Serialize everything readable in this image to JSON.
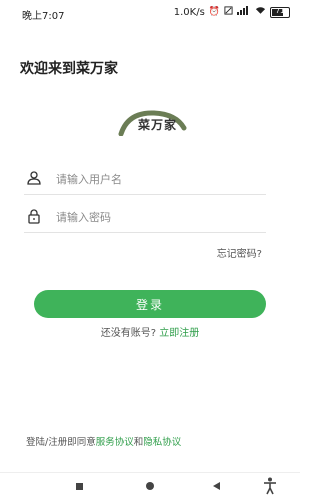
{
  "status_bar": {
    "time": "晚上7:07",
    "speed": "1.0K/s",
    "icons": [
      "alarm-icon",
      "mute-icon",
      "signal-icon",
      "wifi-icon",
      "battery-icon"
    ],
    "battery_label": "71",
    "battery_level": 0.71
  },
  "welcome_text": "欢迎来到菜万家",
  "logo": {
    "text": "菜万家"
  },
  "form": {
    "username_placeholder": "请输入用户名",
    "password_placeholder": "请输入密码",
    "forgot_label": "忘记密码?",
    "login_label": "登录",
    "no_account_text": "还没有账号?",
    "register_label": "立即注册"
  },
  "agreement": {
    "prefix": "登陆/注册即同意",
    "service": "服务协议",
    "and": "和",
    "privacy": "隐私协议"
  },
  "colors": {
    "primary": "#3fb35a",
    "link": "#2f9e4a"
  }
}
